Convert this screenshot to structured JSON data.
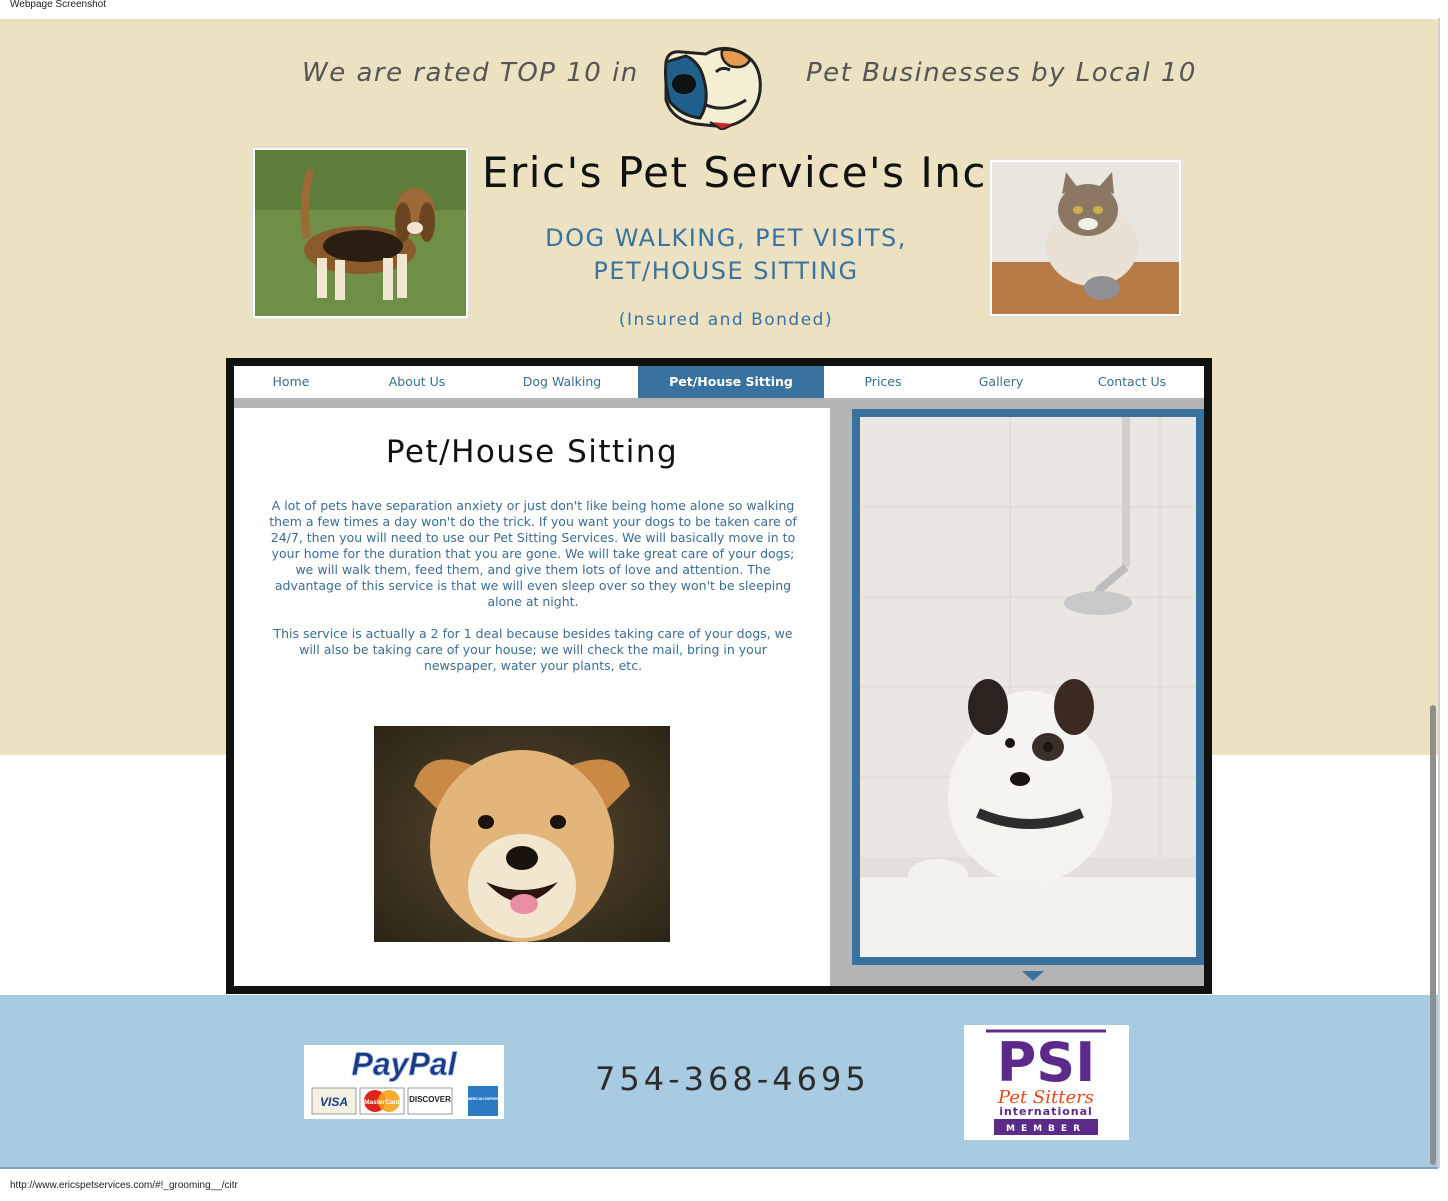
{
  "window": {
    "title": "Webpage Screenshot",
    "status_url": "http://www.ericspetservices.com/#!_grooming__/citr"
  },
  "header": {
    "tagline_left": "We are rated TOP 10 in",
    "tagline_right": "Pet Businesses by Local 10",
    "site_title": "Eric's Pet Service's Inc.",
    "services_line1": "DOG WALKING, PET VISITS,",
    "services_line2": "PET/HOUSE SITTING",
    "insured": "(Insured and Bonded)"
  },
  "nav": {
    "items": [
      {
        "label": "Home"
      },
      {
        "label": "About Us"
      },
      {
        "label": "Dog Walking"
      },
      {
        "label": "Pet/House Sitting",
        "active": true
      },
      {
        "label": "Prices"
      },
      {
        "label": "Gallery"
      },
      {
        "label": "Contact Us"
      }
    ]
  },
  "main": {
    "heading": "Pet/House Sitting",
    "paragraph1": "A lot of pets have separation anxiety or just don't like being home alone so walking them a few times a day won't do the trick.  If you want your dogs to be taken care of 24/7, then you will need to use our Pet Sitting Services.  We will basically move in to your home for the duration that you are gone.  We will take great care of your dogs; we will walk them, feed them, and give them lots of love and attention.  The advantage of this service is that we will even sleep over so they won't be sleeping alone at night.",
    "paragraph2": "This service is actually a 2 for 1 deal because besides taking care of your dogs, we will also be taking care of your house; we will check the mail, bring in your newspaper, water your plants, etc."
  },
  "footer": {
    "phone": "754-368-4695",
    "paypal": {
      "brand": "PayPal",
      "cards": [
        "VISA",
        "MasterCard",
        "DISCOVER",
        "AMERICAN EXPRESS"
      ]
    },
    "psi": {
      "brand": "PSI",
      "line1": "Pet Sitters",
      "line2": "international",
      "line3": "MEMBER"
    }
  },
  "colors": {
    "top_band": "#ece2c2",
    "bottom_band": "#a8cbe2",
    "accent_blue": "#3a729f",
    "frame_black": "#111111"
  }
}
